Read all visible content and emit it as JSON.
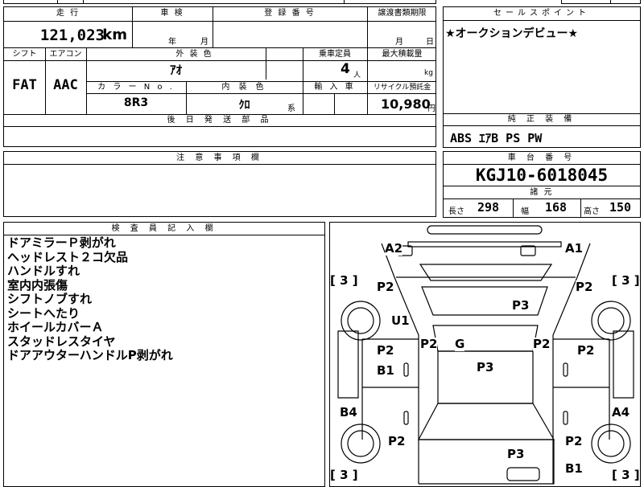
{
  "header": {
    "mileage_label": "走 行",
    "inspection_label": "車 検",
    "registration_label": "登 録 番 号",
    "transfer_deadline_label": "譲渡書類期限",
    "sales_point_label": "セールスポイント"
  },
  "mileage": {
    "value": "121,023",
    "unit": "km"
  },
  "inspection": {
    "year_unit": "年",
    "month_unit": "月"
  },
  "transfer_deadline": {
    "month_unit": "月",
    "day_unit": "日"
  },
  "sales_point": "★オークションデビュー★",
  "row2": {
    "shift_label": "シフト",
    "aircon_label": "エアコン",
    "exterior_color_label": "外 装 色",
    "capacity_label": "乗車定員",
    "max_load_label": "最大積載量",
    "shift": "FAT",
    "aircon": "AAC",
    "exterior_color": "ｱｵ",
    "capacity": "4",
    "capacity_unit": "人",
    "load_unit": "kg",
    "color_no_label": "カ ラ ー N o .",
    "interior_color_label": "内 装 色",
    "import_label": "輸 入 車",
    "recycle_label": "リサイクル預託金",
    "color_no": "8R3",
    "interior_color": "ｸﾛ",
    "interior_suffix": "系",
    "recycle_fee": "10,980",
    "recycle_unit": "円"
  },
  "later_parts_label": "後 日 発 送 部 品",
  "genuine_equipment": {
    "label": "純 正 装 備",
    "value": "ABS ｴｱB PS PW"
  },
  "notes_label": "注 意 事 項 欄",
  "chassis": {
    "label": "車 台 番 号",
    "value": "KGJ10-6018045"
  },
  "specs": {
    "label": "諸 元",
    "length_label": "長さ",
    "length": "298",
    "width_label": "幅",
    "width": "168",
    "height_label": "高さ",
    "height": "150"
  },
  "inspector": {
    "label": "検 査 員 記 入 欄",
    "lines": [
      "ドアミラーＰ剥がれ",
      "ヘッドレスト２コ欠品",
      "ハンドルすれ",
      "室内内張傷",
      "シフトノブすれ",
      "シートへたり",
      "ホイールカバーＡ",
      "スタッドレスタイヤ",
      "ドアアウターハンドルP剥がれ"
    ]
  },
  "diagram": {
    "marks": [
      {
        "id": "a2-front-left",
        "text": "A2"
      },
      {
        "id": "a1-front-right",
        "text": "A1"
      },
      {
        "id": "tire-fl",
        "text": "[ 3 ]"
      },
      {
        "id": "tire-fr",
        "text": "[ 3 ]"
      },
      {
        "id": "p2-fender-left",
        "text": "P2"
      },
      {
        "id": "p2-fender-right",
        "text": "P2"
      },
      {
        "id": "p3-hood",
        "text": "P3"
      },
      {
        "id": "u1-left",
        "text": "U1"
      },
      {
        "id": "p2-pillar-left",
        "text": "P2"
      },
      {
        "id": "g-windshield",
        "text": "G"
      },
      {
        "id": "p2-pillar-right",
        "text": "P2"
      },
      {
        "id": "p2-door-left",
        "text": "P2"
      },
      {
        "id": "b1-door-left",
        "text": "B1"
      },
      {
        "id": "p3-roof",
        "text": "P3"
      },
      {
        "id": "p2-door-right",
        "text": "P2"
      },
      {
        "id": "b4-sill-left",
        "text": "B4"
      },
      {
        "id": "a4-sill-right",
        "text": "A4"
      },
      {
        "id": "p2-rear-left",
        "text": "P2"
      },
      {
        "id": "p2-rear-right",
        "text": "P2"
      },
      {
        "id": "p3-rear",
        "text": "P3"
      },
      {
        "id": "b1-rear-right",
        "text": "B1"
      },
      {
        "id": "tire-rl",
        "text": "[ 3 ]"
      },
      {
        "id": "tire-rr",
        "text": "[ 3 ]"
      }
    ]
  }
}
